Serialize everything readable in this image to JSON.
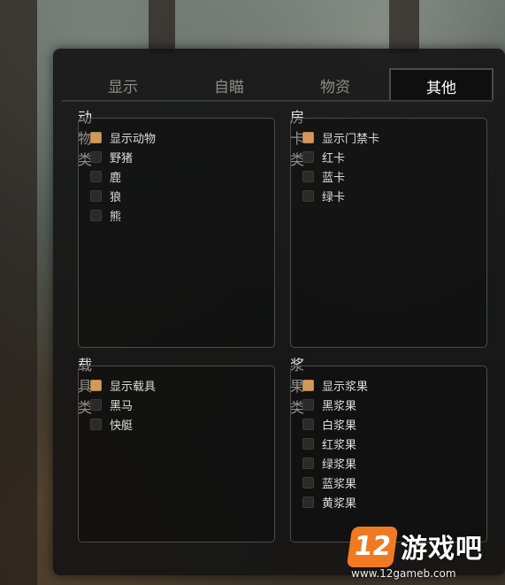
{
  "tabs": [
    {
      "label": "显示"
    },
    {
      "label": "自瞄"
    },
    {
      "label": "物资"
    },
    {
      "label": "其他",
      "active": true
    }
  ],
  "groups": {
    "animals": {
      "title": "动物类",
      "options": [
        {
          "label": "显示动物",
          "checked": true
        },
        {
          "label": "野猪",
          "checked": false
        },
        {
          "label": "鹿",
          "checked": false
        },
        {
          "label": "狼",
          "checked": false
        },
        {
          "label": "熊",
          "checked": false
        }
      ]
    },
    "keycards": {
      "title": "房卡类",
      "options": [
        {
          "label": "显示门禁卡",
          "checked": true
        },
        {
          "label": "红卡",
          "checked": false
        },
        {
          "label": "蓝卡",
          "checked": false
        },
        {
          "label": "绿卡",
          "checked": false
        }
      ]
    },
    "vehicles": {
      "title": "载具类",
      "options": [
        {
          "label": "显示载具",
          "checked": true
        },
        {
          "label": "黑马",
          "checked": false
        },
        {
          "label": "快艇",
          "checked": false
        }
      ]
    },
    "berries": {
      "title": "浆果类",
      "options": [
        {
          "label": "显示浆果",
          "checked": true
        },
        {
          "label": "黑浆果",
          "checked": false
        },
        {
          "label": "白浆果",
          "checked": false
        },
        {
          "label": "红浆果",
          "checked": false
        },
        {
          "label": "绿浆果",
          "checked": false
        },
        {
          "label": "蓝浆果",
          "checked": false
        },
        {
          "label": "黄浆果",
          "checked": false
        }
      ]
    }
  },
  "colors": {
    "checked": "#d19a5c",
    "unchecked": "#2a2a29"
  },
  "watermark": {
    "logo": "12",
    "text": "游戏吧",
    "url": "www.12gameb.com"
  }
}
